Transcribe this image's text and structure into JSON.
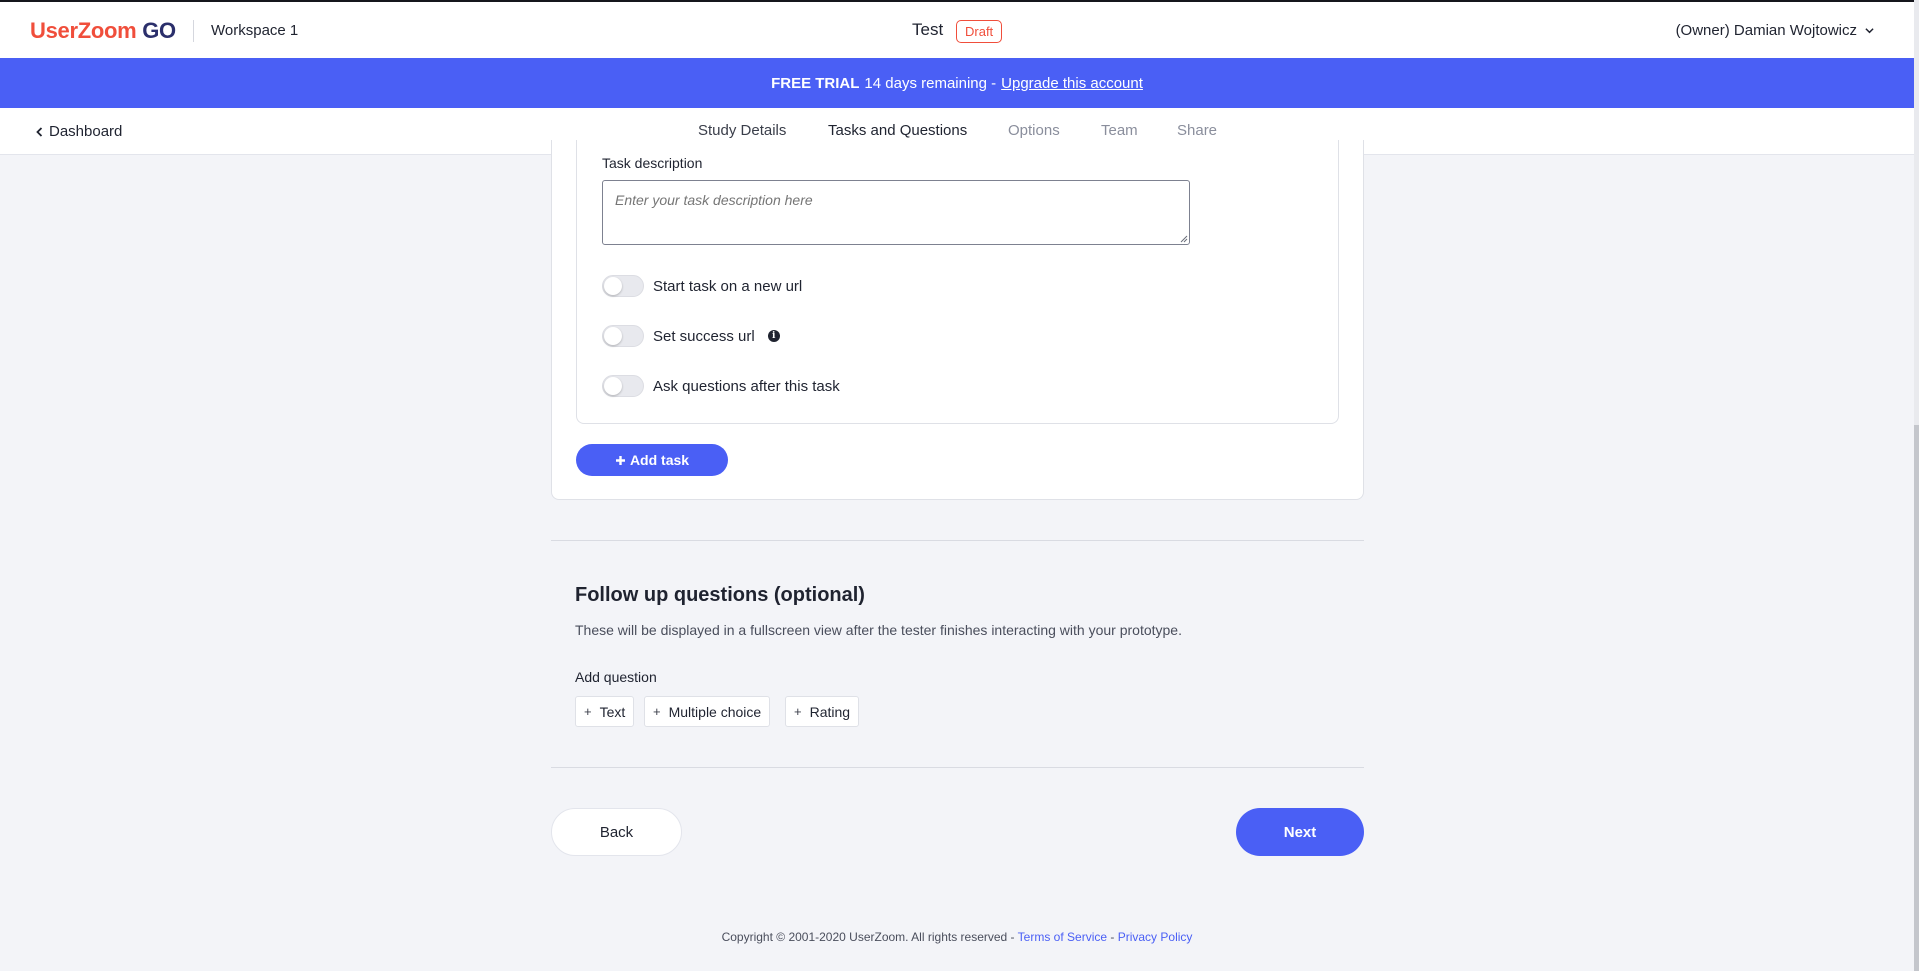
{
  "header": {
    "logo_main": "UserZoom",
    "logo_suffix": "GO",
    "workspace": "Workspace 1",
    "study_title": "Test",
    "status_badge": "Draft",
    "user": "(Owner) Damian Wojtowicz"
  },
  "banner": {
    "bold": "FREE TRIAL",
    "text": "14 days remaining -",
    "link": "Upgrade this account"
  },
  "nav": {
    "back_label": "Dashboard",
    "tabs": [
      {
        "label": "Study Details"
      },
      {
        "label": "Tasks and Questions"
      },
      {
        "label": "Options"
      },
      {
        "label": "Team"
      },
      {
        "label": "Share"
      }
    ]
  },
  "task": {
    "description_label": "Task description",
    "description_placeholder": "Enter your task description here",
    "description_value": "",
    "toggles": [
      {
        "label": "Start task on a new url",
        "on": false
      },
      {
        "label": "Set success url",
        "on": false
      },
      {
        "label": "Ask questions after this task",
        "on": false
      }
    ],
    "add_task": "Add task"
  },
  "follow_up": {
    "title": "Follow up questions (optional)",
    "description": "These will be displayed in a fullscreen view after the tester finishes interacting with your prototype.",
    "add_question_label": "Add question",
    "question_types": [
      "Text",
      "Multiple choice",
      "Rating"
    ]
  },
  "actions": {
    "back": "Back",
    "next": "Next"
  },
  "footer": {
    "copyright": "Copyright © 2001-2020 UserZoom. All rights reserved -",
    "terms": "Terms of Service",
    "separator": "-",
    "privacy": "Privacy Policy"
  },
  "colors": {
    "brand_red": "#f04e3b",
    "brand_blue": "#4a5ff5",
    "logo_navy": "#2b2f6b"
  }
}
